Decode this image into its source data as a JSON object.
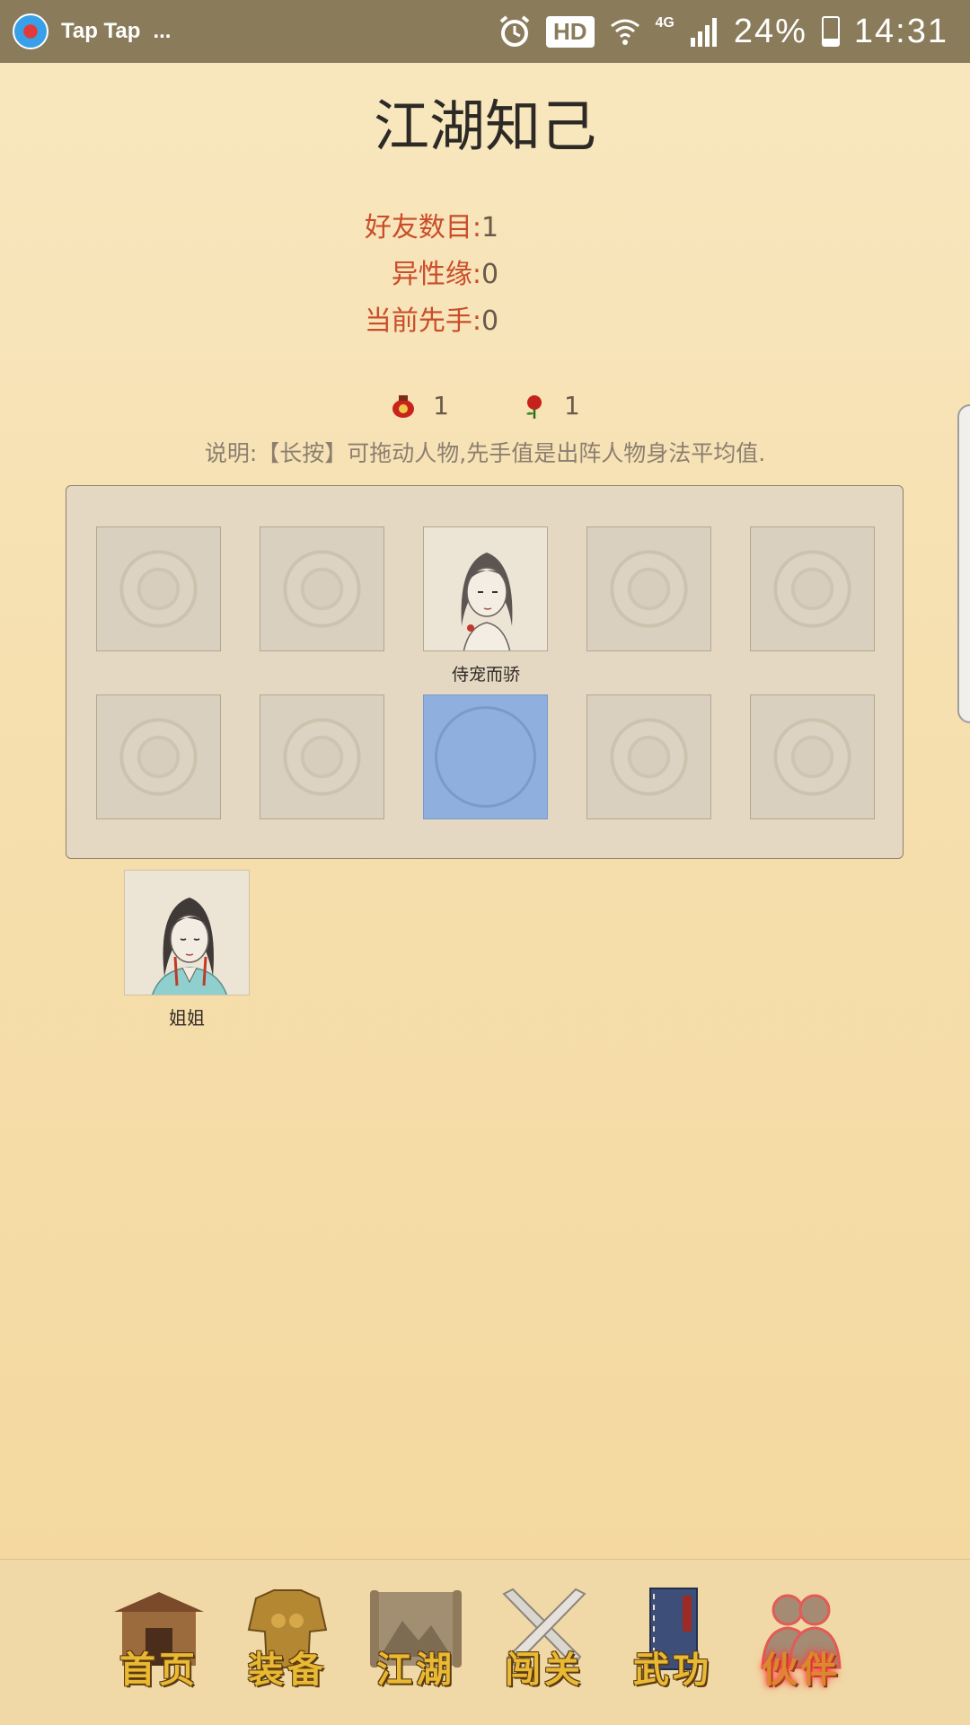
{
  "status_bar": {
    "app_name": "Tap Tap",
    "ellipsis": "...",
    "hd": "HD",
    "network": "4G",
    "battery": "24%",
    "battery_level": 0.24,
    "time": "14:31"
  },
  "page": {
    "title": "江湖知己",
    "stats": [
      {
        "label": "好友数目:",
        "value": "1"
      },
      {
        "label": "异性缘:",
        "value": "0"
      },
      {
        "label": "当前先手:",
        "value": "0"
      }
    ],
    "resources": [
      {
        "icon": "wine-jar-icon",
        "count": "1"
      },
      {
        "icon": "rose-icon",
        "count": "1"
      }
    ],
    "hint": "说明:【长按】可拖动人物,先手值是出阵人物身法平均值."
  },
  "formation": {
    "slots": [
      {
        "state": "empty"
      },
      {
        "state": "empty"
      },
      {
        "state": "occupied",
        "character": "侍宠而骄"
      },
      {
        "state": "empty"
      },
      {
        "state": "empty"
      },
      {
        "state": "empty"
      },
      {
        "state": "empty"
      },
      {
        "state": "selected"
      },
      {
        "state": "empty"
      },
      {
        "state": "empty"
      }
    ],
    "occupied_name": "侍宠而骄"
  },
  "reserve": {
    "name": "姐姐"
  },
  "bottom_nav": {
    "items": [
      {
        "label": "首页",
        "icon": "house-icon"
      },
      {
        "label": "装备",
        "icon": "armor-icon"
      },
      {
        "label": "江湖",
        "icon": "scroll-map-icon"
      },
      {
        "label": "闯关",
        "icon": "crossed-swords-icon"
      },
      {
        "label": "武功",
        "icon": "book-icon"
      },
      {
        "label": "伙伴",
        "icon": "partners-icon",
        "active": true
      }
    ]
  }
}
